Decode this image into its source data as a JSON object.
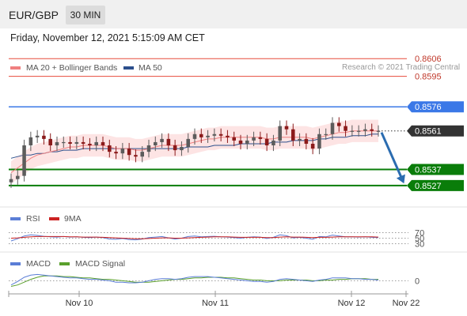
{
  "header": {
    "symbol": "EUR/GBP",
    "timeframe": "30 MIN"
  },
  "datetime": "Friday, November 12, 2021 5:15:09 AM CET",
  "credit": "Research © 2021 Trading Central",
  "colors": {
    "ma20": "#f08080",
    "ma50": "#2c4f8c",
    "resistance": "#e74c3c",
    "pivot": "#3b78e7",
    "support": "#0a7d0a",
    "last": "#333333",
    "arrow": "#2b6cb0",
    "rsi": "#5b7ed6",
    "rsi_ma": "#cc2222",
    "macd": "#5b7ed6",
    "macd_signal": "#5aa02c",
    "candle_up": "#5c5c5c",
    "candle_down": "#8b1a1a",
    "band": "#fde4e4"
  },
  "chart_data": [
    {
      "type": "candlestick",
      "legend": [
        "MA 20 + Bollinger Bands",
        "MA 50"
      ],
      "ylim": [
        0.8522,
        0.8612
      ],
      "x_labels": [
        "Nov 10",
        "Nov 11",
        "Nov 12",
        "Nov 22"
      ],
      "levels": [
        {
          "value": 0.8606,
          "label": "0.8606",
          "kind": "resistance"
        },
        {
          "value": 0.8595,
          "label": "0.8595",
          "kind": "resistance"
        },
        {
          "value": 0.8576,
          "label": "0.8576",
          "kind": "pivot"
        },
        {
          "value": 0.8561,
          "label": "0.8561",
          "kind": "last"
        },
        {
          "value": 0.8537,
          "label": "0.8537",
          "kind": "support"
        },
        {
          "value": 0.8527,
          "label": "0.8527",
          "kind": "support"
        }
      ],
      "closes": [
        0.8531,
        0.8533,
        0.8552,
        0.8557,
        0.8558,
        0.8556,
        0.8552,
        0.8554,
        0.8554,
        0.8553,
        0.8554,
        0.8553,
        0.8552,
        0.8554,
        0.8552,
        0.8548,
        0.8547,
        0.855,
        0.8546,
        0.8545,
        0.8548,
        0.8552,
        0.8554,
        0.8556,
        0.8552,
        0.8549,
        0.8551,
        0.8556,
        0.8559,
        0.8557,
        0.8558,
        0.8559,
        0.8558,
        0.8557,
        0.8555,
        0.8553,
        0.8555,
        0.8557,
        0.8556,
        0.8552,
        0.8555,
        0.8564,
        0.8562,
        0.8555,
        0.8556,
        0.8553,
        0.855,
        0.8559,
        0.8559,
        0.8566,
        0.8564,
        0.8561,
        0.8561,
        0.8561,
        0.8562,
        0.8561,
        0.8561
      ],
      "ma20": [
        0.8535,
        0.8538,
        0.8541,
        0.8544,
        0.8546,
        0.8547,
        0.8548,
        0.8549,
        0.855,
        0.8551,
        0.8551,
        0.8552,
        0.8552,
        0.8552,
        0.8552,
        0.8551,
        0.855,
        0.855,
        0.855,
        0.8549,
        0.8549,
        0.855,
        0.8551,
        0.8552,
        0.8552,
        0.8552,
        0.8552,
        0.8553,
        0.8554,
        0.8555,
        0.8556,
        0.8556,
        0.8557,
        0.8557,
        0.8557,
        0.8557,
        0.8557,
        0.8557,
        0.8557,
        0.8556,
        0.8556,
        0.8557,
        0.8557,
        0.8557,
        0.8557,
        0.8557,
        0.8556,
        0.8557,
        0.8558,
        0.8559,
        0.856,
        0.856,
        0.8561,
        0.8561,
        0.8561,
        0.8561,
        0.8561
      ],
      "ma50": [
        0.8544,
        0.8545,
        0.8546,
        0.8546,
        0.8547,
        0.8547,
        0.8548,
        0.8548,
        0.8549,
        0.8549,
        0.8549,
        0.855,
        0.855,
        0.855,
        0.855,
        0.855,
        0.855,
        0.855,
        0.855,
        0.855,
        0.855,
        0.855,
        0.855,
        0.855,
        0.855,
        0.855,
        0.855,
        0.8551,
        0.8551,
        0.8551,
        0.8551,
        0.8552,
        0.8552,
        0.8552,
        0.8552,
        0.8553,
        0.8553,
        0.8553,
        0.8553,
        0.8553,
        0.8554,
        0.8554,
        0.8554,
        0.8555,
        0.8555,
        0.8555,
        0.8555,
        0.8556,
        0.8556,
        0.8557,
        0.8557,
        0.8557,
        0.8558,
        0.8558,
        0.8558,
        0.8559,
        0.8559
      ],
      "band_width": 0.0007,
      "forecast": {
        "from": 0.8561,
        "to": 0.853
      }
    },
    {
      "type": "line",
      "legend": [
        "RSI",
        "9MA"
      ],
      "ylim": [
        20,
        80
      ],
      "ticks": [
        "70",
        "50",
        "30"
      ],
      "series": [
        {
          "values": [
            40,
            48,
            58,
            62,
            60,
            57,
            55,
            54,
            56,
            54,
            55,
            53,
            52,
            54,
            52,
            47,
            46,
            49,
            45,
            44,
            47,
            52,
            54,
            56,
            51,
            47,
            50,
            56,
            58,
            55,
            56,
            57,
            55,
            54,
            52,
            50,
            53,
            55,
            54,
            49,
            53,
            62,
            59,
            51,
            53,
            50,
            46,
            56,
            55,
            61,
            58,
            55,
            55,
            54,
            55,
            53,
            52
          ]
        },
        {
          "values": [
            50,
            51,
            53,
            55,
            56,
            56,
            56,
            56,
            56,
            55,
            55,
            54,
            54,
            54,
            53,
            52,
            51,
            50,
            49,
            48,
            48,
            49,
            50,
            51,
            51,
            50,
            50,
            51,
            52,
            53,
            54,
            55,
            55,
            55,
            54,
            53,
            53,
            53,
            53,
            52,
            52,
            54,
            55,
            54,
            54,
            53,
            52,
            53,
            53,
            54,
            55,
            55,
            55,
            55,
            55,
            55,
            54
          ]
        }
      ]
    },
    {
      "type": "line",
      "legend": [
        "MACD",
        "MACD Signal"
      ],
      "ylim": [
        -0.0012,
        0.0014
      ],
      "ticks": [
        "0"
      ],
      "series": [
        {
          "values": [
            -0.0006,
            -0.0001,
            0.0005,
            0.0008,
            0.0009,
            0.0008,
            0.0007,
            0.0006,
            0.0005,
            0.0004,
            0.0004,
            0.0003,
            0.0002,
            0.0002,
            0.0001,
            0.0,
            -0.0002,
            -0.0002,
            -0.0003,
            -0.0003,
            -0.0002,
            0.0,
            0.0002,
            0.0003,
            0.0003,
            0.0002,
            0.0003,
            0.0005,
            0.0006,
            0.0006,
            0.0006,
            0.0005,
            0.0004,
            0.0003,
            0.0002,
            0.0001,
            0.0,
            -0.0001,
            -0.0001,
            -0.0002,
            -0.0001,
            0.0002,
            0.0003,
            0.0002,
            0.0001,
            0.0,
            -0.0001,
            0.0001,
            0.0002,
            0.0004,
            0.0004,
            0.0004,
            0.0003,
            0.0003,
            0.0002,
            0.0002,
            0.0001
          ]
        },
        {
          "values": [
            -0.0008,
            -0.0006,
            -0.0002,
            0.0002,
            0.0005,
            0.0007,
            0.0007,
            0.0007,
            0.0006,
            0.0006,
            0.0005,
            0.0004,
            0.0004,
            0.0003,
            0.0002,
            0.0002,
            0.0001,
            0.0,
            -0.0001,
            -0.0002,
            -0.0002,
            -0.0002,
            -0.0001,
            0.0,
            0.0001,
            0.0002,
            0.0002,
            0.0003,
            0.0004,
            0.0004,
            0.0005,
            0.0005,
            0.0005,
            0.0004,
            0.0004,
            0.0003,
            0.0002,
            0.0001,
            0.0001,
            0.0,
            0.0,
            0.0,
            0.0001,
            0.0001,
            0.0001,
            0.0001,
            0.0,
            0.0,
            0.0001,
            0.0001,
            0.0002,
            0.0002,
            0.0003,
            0.0003,
            0.0003,
            0.0002,
            0.0002
          ]
        }
      ]
    }
  ]
}
